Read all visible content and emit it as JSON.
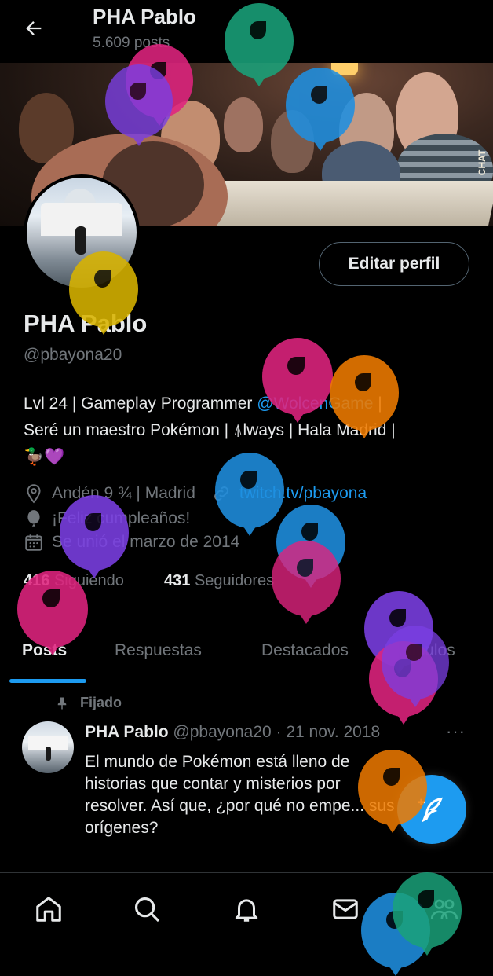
{
  "header": {
    "title": "PHA Pablo",
    "posts_count": "5.609 posts"
  },
  "banner": {
    "watermark": "CHAT"
  },
  "profile": {
    "edit_button": "Editar perfil",
    "name": "PHA Pablo",
    "handle": "@pbayona20",
    "bio_line1_a": "Lvl 24 | Gameplay Programmer ",
    "bio_line1_link": "@WolcenGame",
    "bio_line1_b": " |",
    "bio_line2": "Seré un maestro Pokémon | ⍋lways | Hala Madrid |",
    "bio_line3": "🦆💜",
    "location": "Andén 9 ¾ | Madrid",
    "website": "twitch.tv/pbayona",
    "birthday": "¡Feliz cumpleaños!",
    "joined": "Se unió el marzo de 2014",
    "following_count": "416",
    "following_label": "Siguiendo",
    "followers_count": "431",
    "followers_label": "Seguidores"
  },
  "tabs": [
    {
      "label": "Posts",
      "active": true
    },
    {
      "label": "Respuestas",
      "active": false
    },
    {
      "label": "Destacados",
      "active": false
    },
    {
      "label": "Artículos",
      "active": false
    }
  ],
  "post": {
    "pinned_label": "Fijado",
    "author": "PHA Pablo",
    "meta": "@pbayona20 · 21 nov. 2018",
    "more": "···",
    "text": "El mundo de Pokémon está lleno de historias que contar y misterios por resolver. Así que, ¿por qué no empe... sus orígenes?"
  },
  "nav": [
    "home-icon",
    "search-icon",
    "bell-icon",
    "mail-icon",
    "communities-icon"
  ],
  "colors": {
    "accent": "#1d9bf0",
    "balloon_colors": [
      "#1aa27a",
      "#e0247f",
      "#7b3fe4",
      "#1f8fe0",
      "#d9b400",
      "#f07b00"
    ]
  }
}
